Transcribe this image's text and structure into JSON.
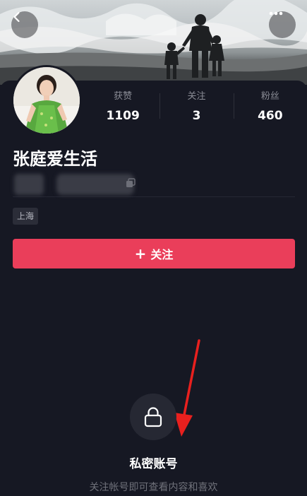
{
  "header": {
    "back_icon": "chevron-left-icon",
    "more_icon": "more-dots-icon"
  },
  "profile": {
    "name": "张庭爱生活",
    "location": "上海",
    "stats": [
      {
        "label": "获赞",
        "value": "1109"
      },
      {
        "label": "关注",
        "value": "3"
      },
      {
        "label": "粉丝",
        "value": "460"
      }
    ]
  },
  "actions": {
    "follow_plus": "+",
    "follow_label": "关注"
  },
  "private": {
    "icon": "lock-icon",
    "title": "私密账号",
    "description": "关注帐号即可查看内容和喜欢"
  },
  "colors": {
    "background": "#161823",
    "accent": "#ea3e5a",
    "annotation_arrow": "#e8201e"
  }
}
